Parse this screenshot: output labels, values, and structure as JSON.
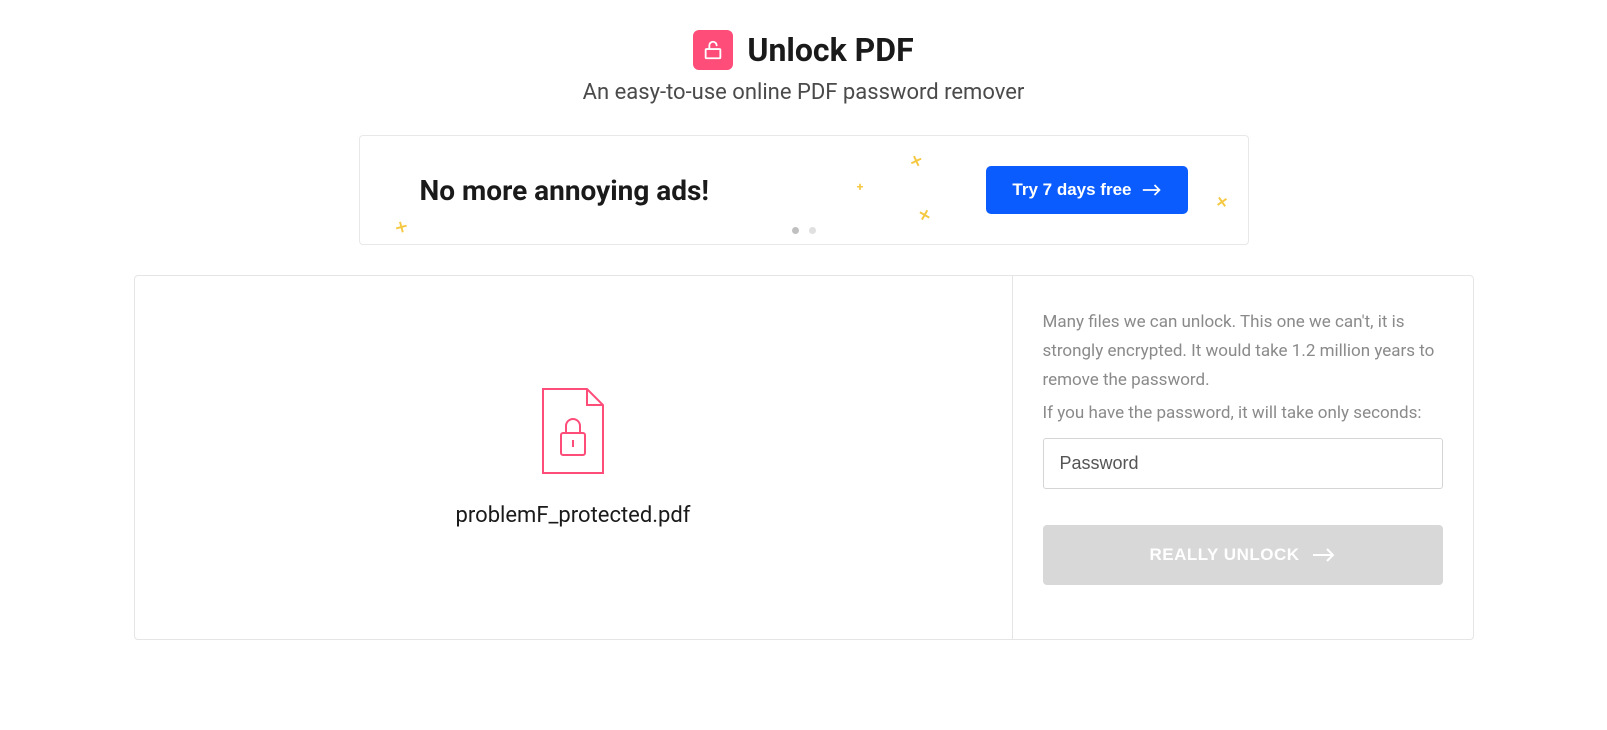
{
  "header": {
    "title": "Unlock PDF",
    "subtitle": "An easy-to-use online PDF password remover"
  },
  "promo": {
    "headline": "No more annoying ads!",
    "cta_label": "Try 7 days free"
  },
  "file": {
    "name": "problemF_protected.pdf"
  },
  "sidebar": {
    "info_text": "Many files we can unlock. This one we can't, it is strongly encrypted. It would take 1.2 million years to remove the password.",
    "prompt_text": "If you have the password, it will take only seconds:",
    "password_placeholder": "Password",
    "unlock_button_label": "REALLY UNLOCK"
  }
}
